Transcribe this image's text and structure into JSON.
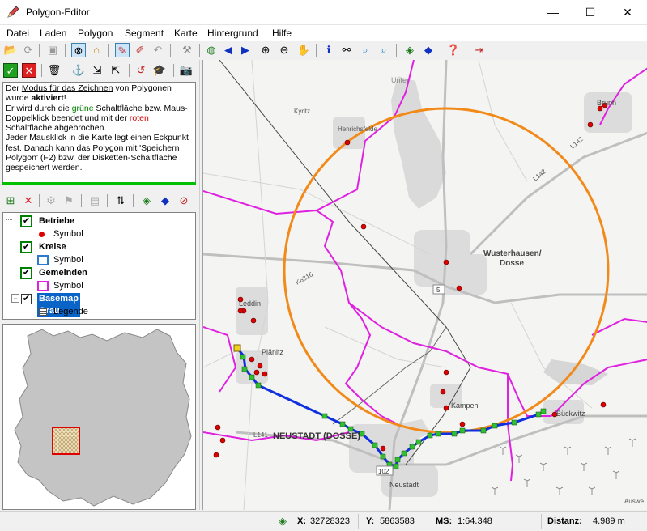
{
  "window": {
    "title": "Polygon-Editor",
    "minimize_glyph": "—",
    "maximize_glyph": "☐",
    "close_glyph": "✕"
  },
  "menu": [
    "Datei",
    "Laden",
    "Polygon",
    "Segment",
    "Karte",
    "Hintergrund",
    "Hilfe"
  ],
  "info": {
    "line1_pre": "Der ",
    "line1_link": "Modus für das Zeichnen",
    "line1_post": " von Polygonen",
    "line2_pre": "wurde ",
    "line2_bold": "aktiviert",
    "line2_post": "!",
    "line3_pre": "Er wird durch die ",
    "line3_green": "grüne",
    "line3_post": " Schaltfläche bzw. Maus-",
    "line4_pre": "Doppelklick beendet und mit der ",
    "line4_red": "roten",
    "line5": "Schaltfläche abgebrochen.",
    "line6": "Jeder Mausklick in die Karte legt einen Eckpunkt",
    "line7": "fest. Danach kann das Polygon mit 'Speichern",
    "line8": "Polygon' (F2) bzw. der Disketten-Schaltfläche",
    "line9": "gespeichert werden."
  },
  "layers": [
    {
      "name": "Betriebe",
      "sub": "Symbol",
      "checked": "✔"
    },
    {
      "name": "Kreise",
      "sub": "Symbol",
      "checked": "✔"
    },
    {
      "name": "Gemeinden",
      "sub": "Symbol",
      "checked": "✔"
    },
    {
      "name": "Basemap Grau",
      "sub": "Legende",
      "checked": "✔"
    }
  ],
  "map_labels": {
    "wusterhausen": "Wusterhausen/\nDosse",
    "wusterhausen_l1": "Wusterhausen/",
    "wusterhausen_l2": "Dosse",
    "neustadt_big": "NEUSTADT (DOSSE)",
    "neustadt": "Neustadt",
    "leddin": "Leddin",
    "plaenitz": "Plänitz",
    "kampehl": "Kampehl",
    "bueckwitz": "Bückwitz",
    "brunn": "Brunn",
    "henrichsfelde": "Henrichsfelde",
    "kyritz": "Kyritz",
    "unter": "Unter",
    "l142": "L142",
    "k6816": "K6816",
    "l141": "L141",
    "n5": "5",
    "n102": "102",
    "auswe": "Auswe"
  },
  "status": {
    "x_label": "X:",
    "x_value": "32728323",
    "y_label": "Y:",
    "y_value": "5863583",
    "ms_label": "MS:",
    "ms_value": "1:64.348",
    "dist_label": "Distanz:",
    "dist_value": "4.989 m"
  },
  "colors": {
    "circle": "#f28a1a",
    "polygon_line": "#1030e0",
    "vertex": "#30c030",
    "gemeinde": "#e020e0",
    "betrieb": "#e00000"
  }
}
